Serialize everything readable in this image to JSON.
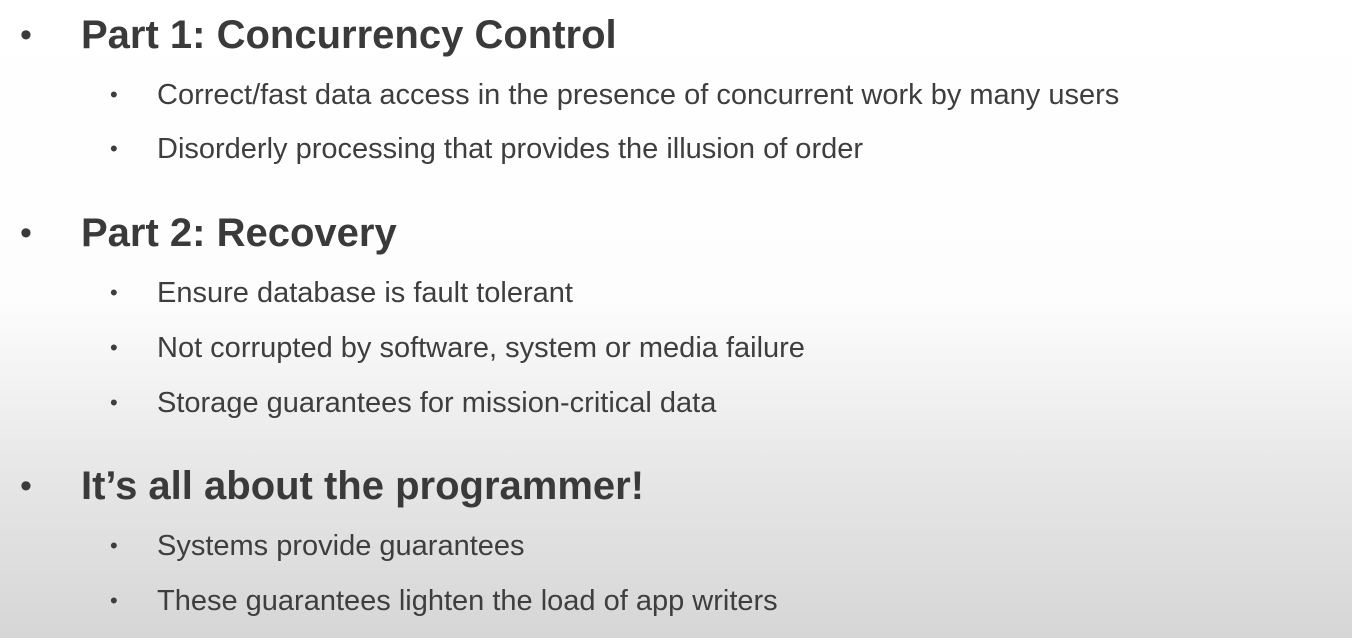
{
  "sections": [
    {
      "heading": "Part 1: Concurrency Control",
      "items": [
        "Correct/fast data access in the presence of concurrent work by many users",
        "Disorderly processing that provides the illusion of order"
      ]
    },
    {
      "heading": "Part 2: Recovery",
      "items": [
        "Ensure database is fault tolerant",
        "Not corrupted by software, system or media failure",
        "Storage guarantees for mission-critical data"
      ]
    },
    {
      "heading": "It’s all about the programmer!",
      "items": [
        "Systems provide guarantees",
        "These guarantees lighten the load of app writers"
      ]
    }
  ],
  "bullet_glyph": "•",
  "colors": {
    "text": "#3a3a3a",
    "background_top": "#ffffff",
    "background_bottom": "#d6d6d6"
  }
}
